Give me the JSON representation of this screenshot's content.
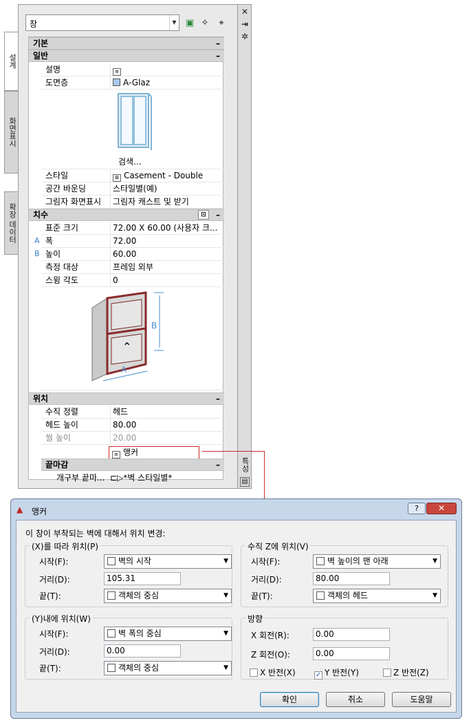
{
  "palette": {
    "style_combo": "창",
    "tabs": [
      "설계",
      "화면표시",
      "확장 데이터"
    ],
    "side_right_label": "특성",
    "categories": {
      "basic": "기본",
      "general": "일반",
      "dimensions": "치수",
      "location": "위치",
      "finish": "끝마감"
    },
    "general_rows": [
      {
        "key": "설명",
        "value": ""
      },
      {
        "key": "도면층",
        "value": "A-Glaz"
      }
    ],
    "browse_label": "검색...",
    "general_rows2": [
      {
        "key": "스타일",
        "value": "Casement - Double"
      },
      {
        "key": "공간 바운딩",
        "value": "스타일별(예)"
      },
      {
        "key": "그림자 화면표시",
        "value": "그림자 캐스트 및 받기"
      }
    ],
    "dim_rows": [
      {
        "key": "표준 크기",
        "value": "72.00  X  60.00 (사용자 크..."
      },
      {
        "key": "폭",
        "value": "72.00",
        "tag": "A"
      },
      {
        "key": "높이",
        "value": "60.00",
        "tag": "B"
      },
      {
        "key": "측정 대상",
        "value": "프레임 외부"
      },
      {
        "key": "스윙 각도",
        "value": "0"
      }
    ],
    "loc_rows": [
      {
        "key": "수직 정렬",
        "value": "헤드"
      },
      {
        "key": "헤드 높이",
        "value": "80.00"
      },
      {
        "key": "씰 높이",
        "value": "20.00"
      }
    ],
    "anchor_value": "앵커",
    "finish_row": {
      "key": "개구부 끝마...",
      "value": "*벽 스타일별*"
    },
    "diagram_labels": {
      "a": "A",
      "b": "B"
    }
  },
  "dialog": {
    "title": "앵커",
    "help": "?",
    "close": "✕",
    "description": "이 창이 부착되는 벽에 대해서 위치 변경:",
    "along": {
      "title": "(X)를 따라 위치(P)",
      "start_label": "시작(F):",
      "start_value": "벽의 시작",
      "distance_label": "거리(D):",
      "distance_value": "105.31",
      "end_label": "끝(T):",
      "end_value": "객체의 중심"
    },
    "vertical": {
      "title": "수직 Z에 위치(V)",
      "start_label": "시작(F):",
      "start_value": "벽 높이의 맨 아래",
      "distance_label": "거리(D):",
      "distance_value": "80.00",
      "end_label": "끝(T):",
      "end_value": "객체의 헤드"
    },
    "within": {
      "title": "(Y)내에 위치(W)",
      "start_label": "시작(F):",
      "start_value": "벽 폭의 중심",
      "distance_label": "거리(D):",
      "distance_value": "0.00",
      "end_label": "끝(T):",
      "end_value": "객체의 중심"
    },
    "orientation": {
      "title": "방향",
      "x_rot_label": "X 회전(R):",
      "x_rot_value": "0.00",
      "z_rot_label": "Z 회전(O):",
      "z_rot_value": "0.00",
      "x_flip": "X 반전(X)",
      "y_flip": "Y 반전(Y)",
      "z_flip": "Z 반전(Z)"
    },
    "buttons": {
      "ok": "확인",
      "cancel": "취소",
      "help": "도움말"
    }
  }
}
